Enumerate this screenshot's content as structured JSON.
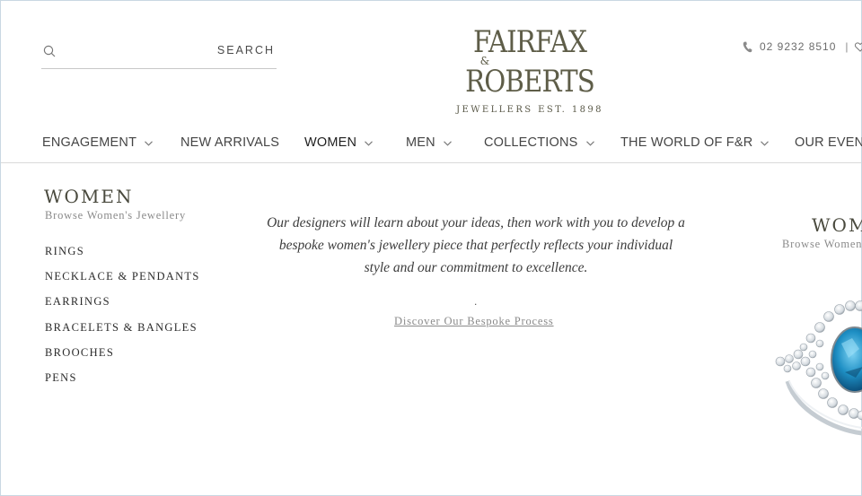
{
  "header": {
    "search_label": "SEARCH",
    "logo": {
      "line1": "FAIRFAX",
      "ampersand": "&",
      "line2": "ROBERTS",
      "tagline": "JEWELLERS EST. 1898"
    },
    "phone": "02 9232 8510",
    "separator": "|"
  },
  "nav": {
    "items": [
      {
        "label": "ENGAGEMENT",
        "dropdown": true
      },
      {
        "label": "NEW ARRIVALS",
        "dropdown": false
      },
      {
        "label": "WOMEN",
        "dropdown": true,
        "active": true
      },
      {
        "label": "MEN",
        "dropdown": true
      },
      {
        "label": "COLLECTIONS",
        "dropdown": true
      },
      {
        "label": "THE WORLD OF F&R",
        "dropdown": true
      },
      {
        "label": "OUR EVENT",
        "dropdown": false
      }
    ]
  },
  "menu": {
    "heading": "WOMEN",
    "subheading": "Browse Women's Jewellery",
    "categories": [
      "RINGS",
      "NECKLACE & PENDANTS",
      "EARRINGS",
      "BRACELETS & BANGLES",
      "BROOCHES",
      "PENS"
    ],
    "description": "Our designers will learn about your ideas, then work with you to develop a bespoke women's jewellery piece that perfectly reflects your individual style and our commitment to excellence.",
    "dot": ".",
    "link": "Discover Our Bespoke Process",
    "right_heading": "WOM",
    "right_subheading": "Browse Women"
  },
  "colors": {
    "logo": "#5e5d48",
    "text": "#3b3b3b",
    "muted": "#8a8a8a",
    "gem": "#1e8fc4"
  },
  "icons": {
    "search": "search-icon",
    "phone": "phone-icon",
    "wishlist": "heart-icon",
    "dropdown": "chevron-down-icon"
  }
}
